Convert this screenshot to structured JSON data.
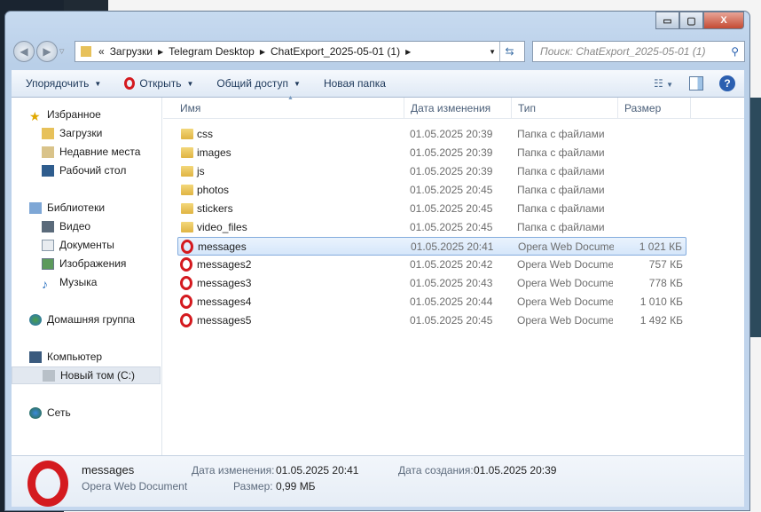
{
  "window": {
    "min": "▭",
    "max": "▢",
    "close": "X"
  },
  "address": {
    "prefix": "«",
    "crumbs": [
      "Загрузки",
      "Telegram Desktop",
      "ChatExport_2025-05-01 (1)"
    ]
  },
  "search": {
    "placeholder": "Поиск: ChatExport_2025-05-01 (1)"
  },
  "toolbar": {
    "organize": "Упорядочить",
    "open": "Открыть",
    "share": "Общий доступ",
    "new_folder": "Новая папка"
  },
  "nav": {
    "favorites": "Избранное",
    "downloads": "Загрузки",
    "recent": "Недавние места",
    "desktop": "Рабочий стол",
    "libraries": "Библиотеки",
    "video": "Видео",
    "documents": "Документы",
    "images": "Изображения",
    "music": "Музыка",
    "homegroup": "Домашняя группа",
    "computer": "Компьютер",
    "drive_c": "Новый том (C:)",
    "network": "Сеть"
  },
  "columns": {
    "name": "Имя",
    "date": "Дата изменения",
    "type": "Тип",
    "size": "Размер"
  },
  "files": [
    {
      "name": "css",
      "date": "01.05.2025 20:39",
      "type": "Папка с файлами",
      "size": "",
      "kind": "folder"
    },
    {
      "name": "images",
      "date": "01.05.2025 20:39",
      "type": "Папка с файлами",
      "size": "",
      "kind": "folder"
    },
    {
      "name": "js",
      "date": "01.05.2025 20:39",
      "type": "Папка с файлами",
      "size": "",
      "kind": "folder"
    },
    {
      "name": "photos",
      "date": "01.05.2025 20:45",
      "type": "Папка с файлами",
      "size": "",
      "kind": "folder"
    },
    {
      "name": "stickers",
      "date": "01.05.2025 20:45",
      "type": "Папка с файлами",
      "size": "",
      "kind": "folder"
    },
    {
      "name": "video_files",
      "date": "01.05.2025 20:45",
      "type": "Папка с файлами",
      "size": "",
      "kind": "folder"
    },
    {
      "name": "messages",
      "date": "01.05.2025 20:41",
      "type": "Opera Web Document",
      "size": "1 021 КБ",
      "kind": "opera",
      "selected": true
    },
    {
      "name": "messages2",
      "date": "01.05.2025 20:42",
      "type": "Opera Web Document",
      "size": "757 КБ",
      "kind": "opera"
    },
    {
      "name": "messages3",
      "date": "01.05.2025 20:43",
      "type": "Opera Web Document",
      "size": "778 КБ",
      "kind": "opera"
    },
    {
      "name": "messages4",
      "date": "01.05.2025 20:44",
      "type": "Opera Web Document",
      "size": "1 010 КБ",
      "kind": "opera"
    },
    {
      "name": "messages5",
      "date": "01.05.2025 20:45",
      "type": "Opera Web Document",
      "size": "1 492 КБ",
      "kind": "opera"
    }
  ],
  "details": {
    "name": "messages",
    "type": "Opera Web Document",
    "modified_label": "Дата изменения:",
    "modified": "01.05.2025 20:41",
    "created_label": "Дата создания:",
    "created": "01.05.2025 20:39",
    "size_label": "Размер:",
    "size": "0,99 МБ"
  }
}
